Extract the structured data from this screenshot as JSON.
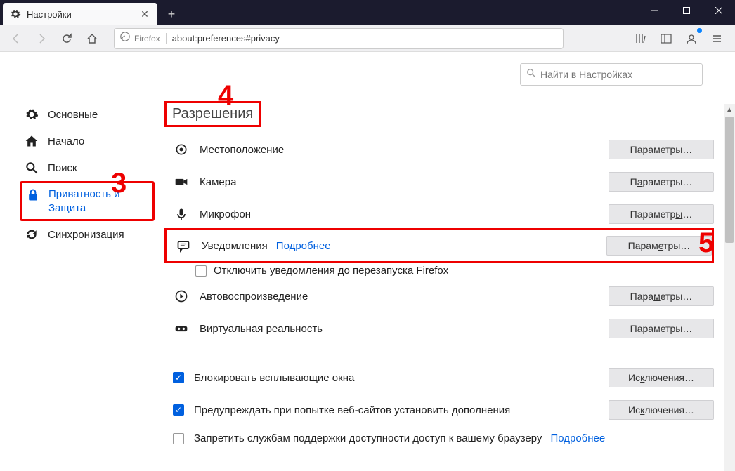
{
  "tab": {
    "title": "Настройки"
  },
  "url": {
    "label": "Firefox",
    "address": "about:preferences#privacy"
  },
  "search": {
    "placeholder": "Найти в Настройках"
  },
  "sidebar": {
    "items": [
      {
        "label": "Основные"
      },
      {
        "label": "Начало"
      },
      {
        "label": "Поиск"
      },
      {
        "label": "Приватность и Защита"
      },
      {
        "label": "Синхронизация"
      }
    ]
  },
  "section": {
    "title": "Разрешения"
  },
  "perms": {
    "location": {
      "label": "Местоположение",
      "btn_pre": "Пара",
      "btn_u": "м",
      "btn_post": "етры…"
    },
    "camera": {
      "label": "Камера",
      "btn_pre": "П",
      "btn_u": "а",
      "btn_post": "раметры…"
    },
    "mic": {
      "label": "Микрофон",
      "btn_pre": "Параметр",
      "btn_u": "ы",
      "btn_post": "…"
    },
    "notif": {
      "label": "Уведомления",
      "link": "Подробнее",
      "btn_pre": "Парам",
      "btn_u": "е",
      "btn_post": "тры…",
      "sub": "Отключить уведомления до перезапуска Firefox"
    },
    "autoplay": {
      "label": "Автовоспроизведение",
      "btn_pre": "Пара",
      "btn_u": "м",
      "btn_post": "етры…"
    },
    "vr": {
      "label": "Виртуальная реальность",
      "btn_pre": "Пара",
      "btn_u": "м",
      "btn_post": "етры…"
    }
  },
  "checks": {
    "popup": {
      "label": "Блокировать всплывающие окна",
      "btn_pre": "Ис",
      "btn_u": "к",
      "btn_post": "лючения…"
    },
    "addon": {
      "label": "Предупреждать при попытке веб-сайтов установить дополнения",
      "btn_pre": "Ис",
      "btn_u": "к",
      "btn_post": "лючения…"
    },
    "access": {
      "label": "Запретить службам поддержки доступности доступ к вашему браузеру",
      "link": "Подробнее"
    }
  },
  "annot": {
    "n3": "3",
    "n4": "4",
    "n5": "5"
  }
}
